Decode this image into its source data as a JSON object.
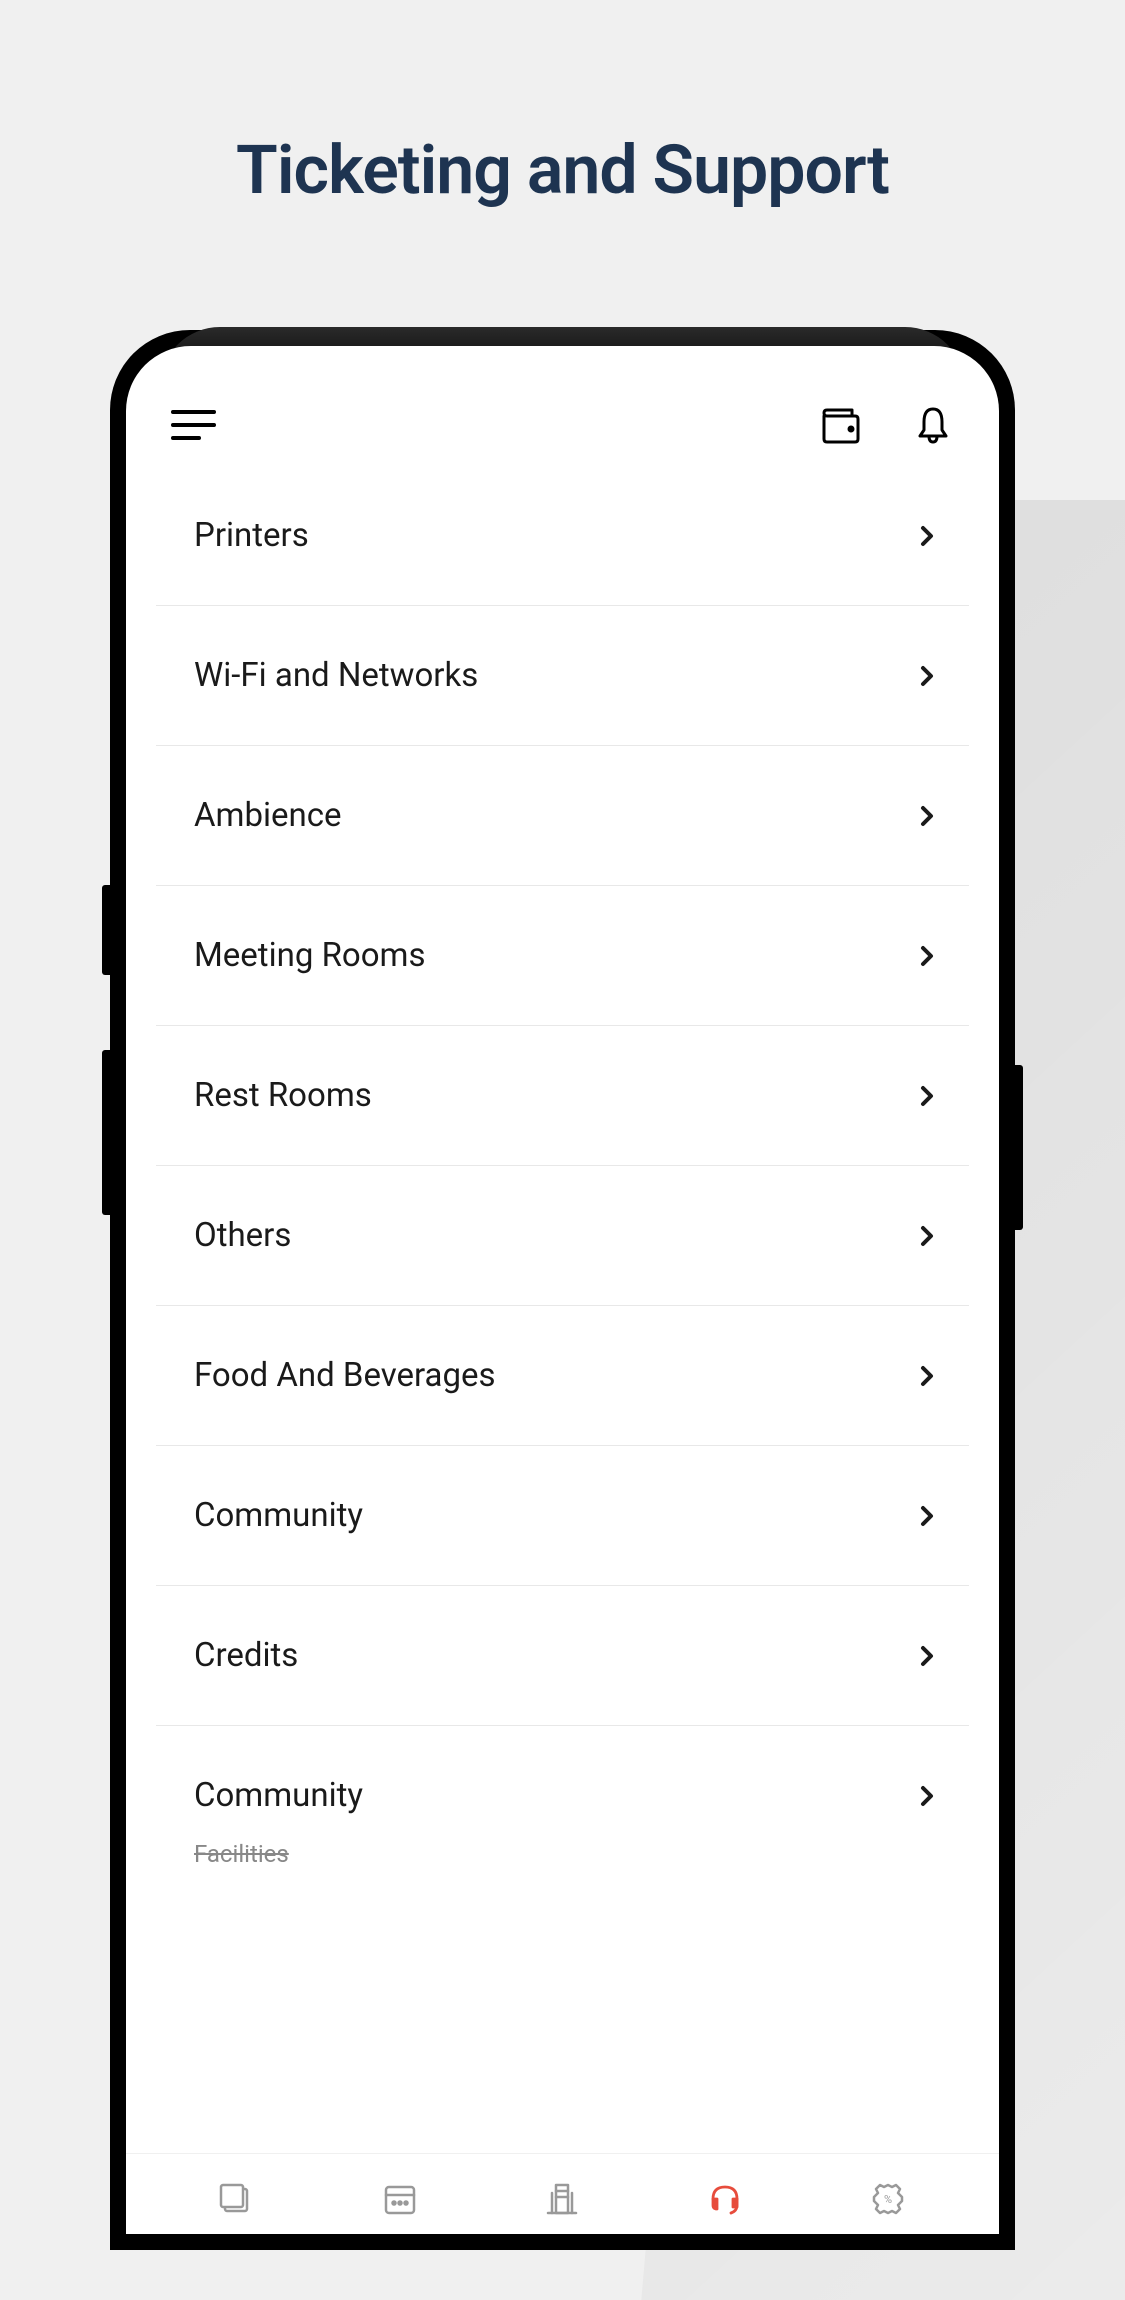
{
  "page": {
    "title": "Ticketing and Support"
  },
  "list": {
    "items": [
      {
        "label": "Printers"
      },
      {
        "label": "Wi-Fi and Networks"
      },
      {
        "label": "Ambience"
      },
      {
        "label": "Meeting Rooms"
      },
      {
        "label": "Rest Rooms"
      },
      {
        "label": "Others"
      },
      {
        "label": "Food And Beverages"
      },
      {
        "label": "Community"
      },
      {
        "label": "Credits"
      },
      {
        "label": "Community",
        "sublabel": "Facilities"
      }
    ]
  },
  "nav": {
    "items": [
      {
        "name": "home",
        "active": false
      },
      {
        "name": "calendar",
        "active": false
      },
      {
        "name": "building",
        "active": false
      },
      {
        "name": "support",
        "active": true
      },
      {
        "name": "settings",
        "active": false
      }
    ]
  }
}
